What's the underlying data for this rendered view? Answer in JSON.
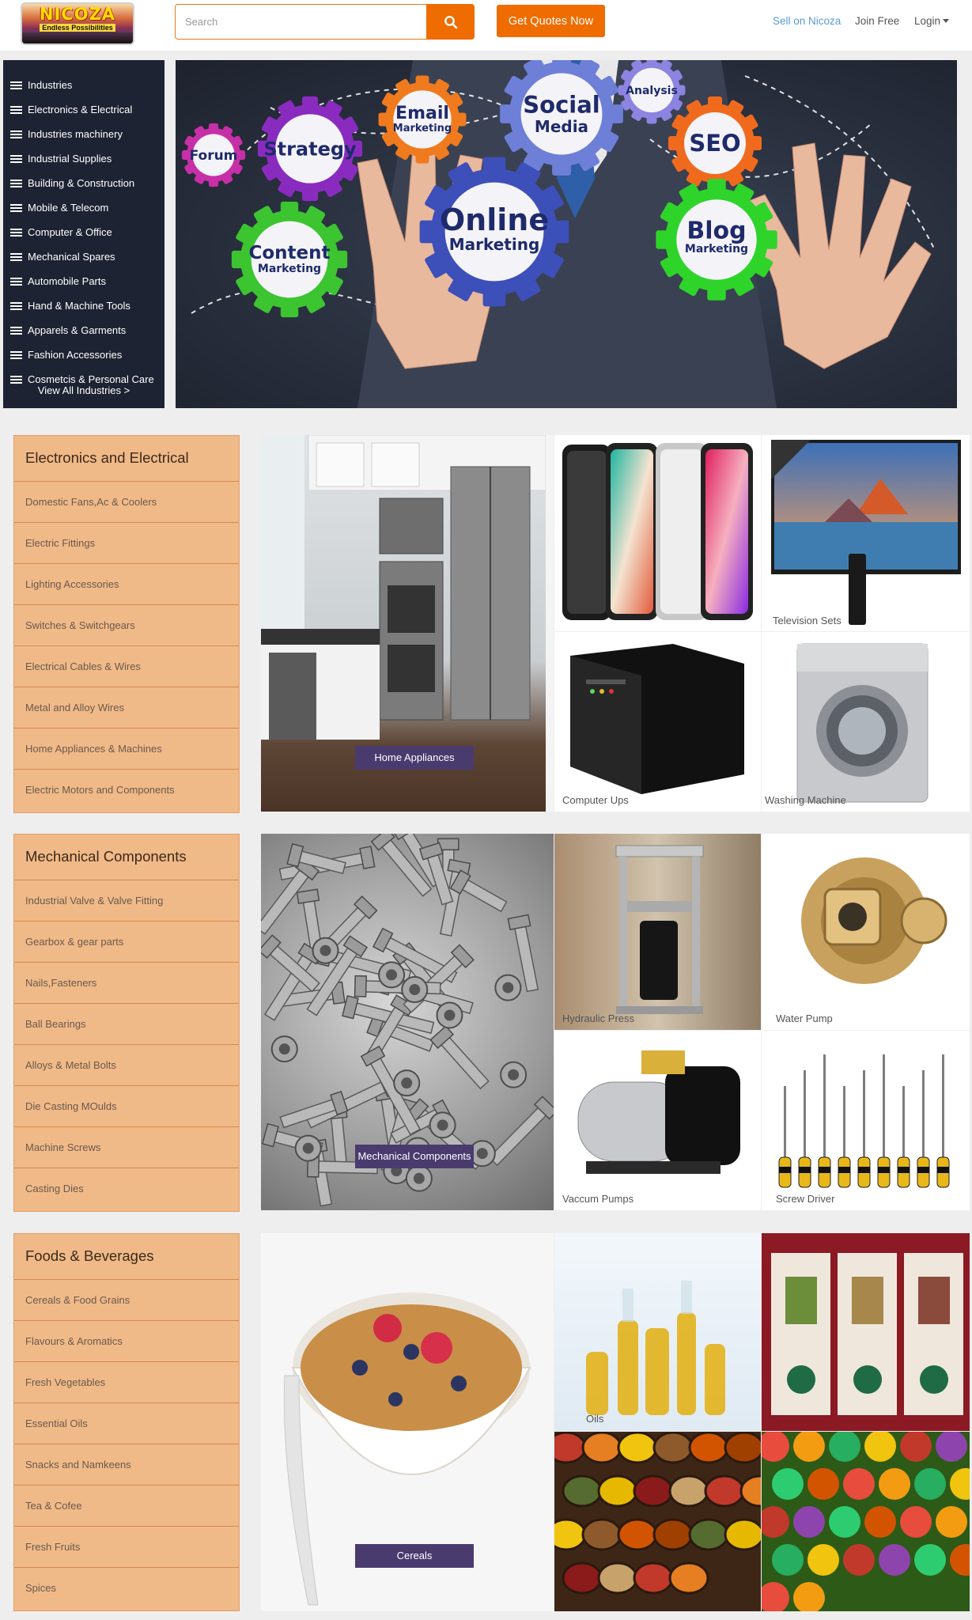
{
  "header": {
    "logo_title": "NICOZA",
    "logo_tagline": "Endless Possibilities",
    "search_placeholder": "Search",
    "get_quotes_label": "Get Quotes Now",
    "sell_label": "Sell on Nicoza",
    "join_label": "Join Free",
    "login_label": "Login"
  },
  "sidebar": {
    "items": [
      {
        "label": "Industries"
      },
      {
        "label": "Electronics & Electrical"
      },
      {
        "label": "Industries machinery"
      },
      {
        "label": "Industrial Supplies"
      },
      {
        "label": "Building & Construction"
      },
      {
        "label": "Mobile & Telecom"
      },
      {
        "label": "Computer & Office"
      },
      {
        "label": "Mechanical Spares"
      },
      {
        "label": "Automobile Parts"
      },
      {
        "label": "Hand & Machine Tools"
      },
      {
        "label": "Apparels & Garments"
      },
      {
        "label": "Fashion Accessories"
      },
      {
        "label": "Cosmetcis & Personal Care"
      }
    ],
    "view_all_label": "View All Industries >"
  },
  "banner": {
    "gears": [
      {
        "title": "Forum",
        "subtitle": "",
        "color": "#c72fa8"
      },
      {
        "title": "Strategy",
        "subtitle": "",
        "color": "#8a2bbf"
      },
      {
        "title": "Email",
        "subtitle": "Marketing",
        "color": "#f07a1e"
      },
      {
        "title": "Social",
        "subtitle": "Media",
        "color": "#6e7fd8"
      },
      {
        "title": "Analysis",
        "subtitle": "",
        "color": "#8c84e0"
      },
      {
        "title": "SEO",
        "subtitle": "",
        "color": "#f06a1e"
      },
      {
        "title": "Online",
        "subtitle": "Marketing",
        "color": "#3d4fb8"
      },
      {
        "title": "Content",
        "subtitle": "Marketing",
        "color": "#3cc431"
      },
      {
        "title": "Blog",
        "subtitle": "Marketing",
        "color": "#2ed42a"
      }
    ]
  },
  "sections": [
    {
      "heading": "Electronics and Electrical",
      "items": [
        "Domestic Fans,Ac & Coolers",
        "Electric Fittings",
        "Lighting Accessories",
        "Switches & Switchgears",
        "Electrical Cables & Wires",
        "Metal and Alloy Wires",
        "Home Appliances & Machines",
        "Electric Motors and Components"
      ],
      "feature_label": "Home Appliances",
      "tiles": [
        "",
        "Television Sets",
        "Computer Ups",
        "Washing Machine"
      ]
    },
    {
      "heading": "Mechanical Components",
      "items": [
        "Industrial Valve & Valve Fitting",
        "Gearbox & gear parts",
        "Nails,Fasteners",
        "Ball Bearings",
        "Alloys & Metal Bolts",
        "Die Casting MOulds",
        "Machine Screws",
        "Casting Dies"
      ],
      "feature_label": "Mechanical Components",
      "tiles": [
        "Hydraulic Press",
        "Water Pump",
        "Vaccum Pumps",
        "Screw Driver"
      ]
    },
    {
      "heading": "Foods & Beverages",
      "items": [
        "Cereals & Food Grains",
        "Flavours & Aromatics",
        "Fresh Vegetables",
        "Essential Oils",
        "Snacks and Namkeens",
        "Tea & Cofee",
        "Fresh Fruits",
        "Spices"
      ],
      "feature_label": "Cereals",
      "tiles": [
        "Oils",
        "",
        "",
        ""
      ]
    }
  ],
  "colors": {
    "accent": "#ef6c00",
    "sidebar_bg": "#1e2333",
    "category_panel": "#f0b988",
    "caption_bg": "#4a3b6f",
    "link_blue": "#5b9bd5"
  }
}
